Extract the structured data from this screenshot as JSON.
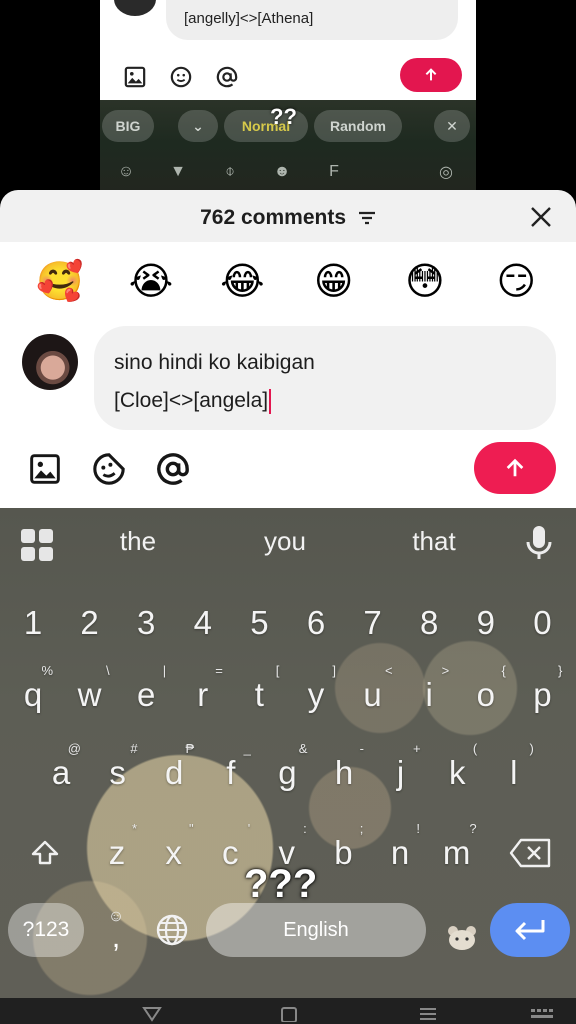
{
  "background_screen": {
    "comment_text": "[angelly]<>[Athena]",
    "keyboard_chips": [
      "BIG",
      "Normal",
      "Random"
    ],
    "overlay_text": "??"
  },
  "comments": {
    "count_label": "762 comments"
  },
  "emoji_bar": [
    "🥰",
    "😭",
    "😂",
    "😁",
    "😳",
    "😏"
  ],
  "composer": {
    "line1": "sino hindi ko kaibigan",
    "line2": "[Cloe]<>[angela]"
  },
  "keyboard": {
    "suggestions": [
      "the",
      "you",
      "that"
    ],
    "number_row": [
      "1",
      "2",
      "3",
      "4",
      "5",
      "6",
      "7",
      "8",
      "9",
      "0"
    ],
    "row1": [
      {
        "k": "q",
        "h": "%"
      },
      {
        "k": "w",
        "h": "\\"
      },
      {
        "k": "e",
        "h": "|"
      },
      {
        "k": "r",
        "h": "="
      },
      {
        "k": "t",
        "h": "["
      },
      {
        "k": "y",
        "h": "]"
      },
      {
        "k": "u",
        "h": "<"
      },
      {
        "k": "i",
        "h": ">"
      },
      {
        "k": "o",
        "h": "{"
      },
      {
        "k": "p",
        "h": "}"
      }
    ],
    "row2": [
      {
        "k": "a",
        "h": "@"
      },
      {
        "k": "s",
        "h": "#"
      },
      {
        "k": "d",
        "h": "₱"
      },
      {
        "k": "f",
        "h": "_"
      },
      {
        "k": "g",
        "h": "&"
      },
      {
        "k": "h",
        "h": "-"
      },
      {
        "k": "j",
        "h": "+"
      },
      {
        "k": "k",
        "h": "("
      },
      {
        "k": "l",
        "h": ")"
      }
    ],
    "row3": [
      {
        "k": "z",
        "h": "*"
      },
      {
        "k": "x",
        "h": "\""
      },
      {
        "k": "c",
        "h": "'"
      },
      {
        "k": "v",
        "h": ":"
      },
      {
        "k": "b",
        "h": ";"
      },
      {
        "k": "n",
        "h": "!"
      },
      {
        "k": "m",
        "h": "?"
      }
    ],
    "symbols_label": "?123",
    "comma_label": ",",
    "space_label": "English",
    "overlay_text": "???"
  },
  "colors": {
    "send": "#ee1d52",
    "enter": "#5c8ef2"
  }
}
